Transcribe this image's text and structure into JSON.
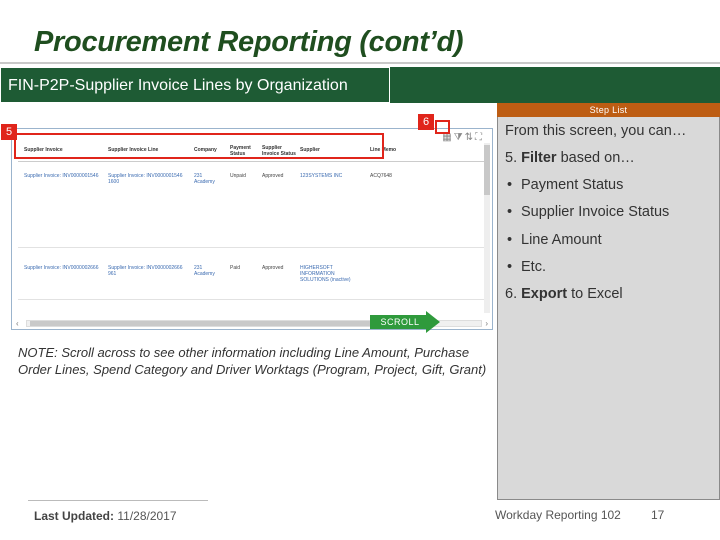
{
  "title": "Procurement Reporting (cont’d)",
  "banner": "FIN-P2P-Supplier Invoice Lines by Organization",
  "step_list": {
    "header": "Step List",
    "intro": "From this screen, you can…",
    "step5_num": "5.",
    "step5_bold": "Filter",
    "step5_rest": "based on…",
    "bullets": [
      "Payment Status",
      "Supplier Invoice Status",
      "Line Amount",
      "Etc."
    ],
    "step6_num": "6.",
    "step6_bold": "Export",
    "step6_rest": "to Excel"
  },
  "markers": {
    "five": "5",
    "six": "6"
  },
  "screenshot": {
    "columns": [
      "Supplier Invoice",
      "Supplier Invoice Line",
      "Company",
      "Payment Status",
      "Supplier Invoice Status",
      "Supplier",
      "Line Memo"
    ],
    "rows": [
      [
        "Supplier Invoice: INV0000001546",
        "Supplier Invoice: INV0000001546 1600",
        "231 Academy",
        "Unpaid",
        "Approved",
        "123SYSTEMS INC",
        "ACQ7648"
      ],
      [
        "Supplier Invoice: INV0000002666",
        "Supplier Invoice: INV0000002666 961",
        "231 Academy",
        "Paid",
        "Approved",
        "HIGHERSOFT INFORMATION SOLUTIONS (inactive)",
        ""
      ]
    ]
  },
  "scroll_label": "SCROLL",
  "note": "NOTE: Scroll across to see other information including Line Amount, Purchase Order Lines, Spend Category and Driver Worktags (Program, Project, Gift, Grant)",
  "footer": {
    "updated_label": "Last Updated:",
    "updated_value": "11/28/2017",
    "course": "Workday Reporting 102",
    "page": "17"
  },
  "colors": {
    "banner": "#1e5b34",
    "step_header": "#bd5d13",
    "highlight": "#e0251b",
    "scroll_arrow": "#2f9a3c"
  }
}
